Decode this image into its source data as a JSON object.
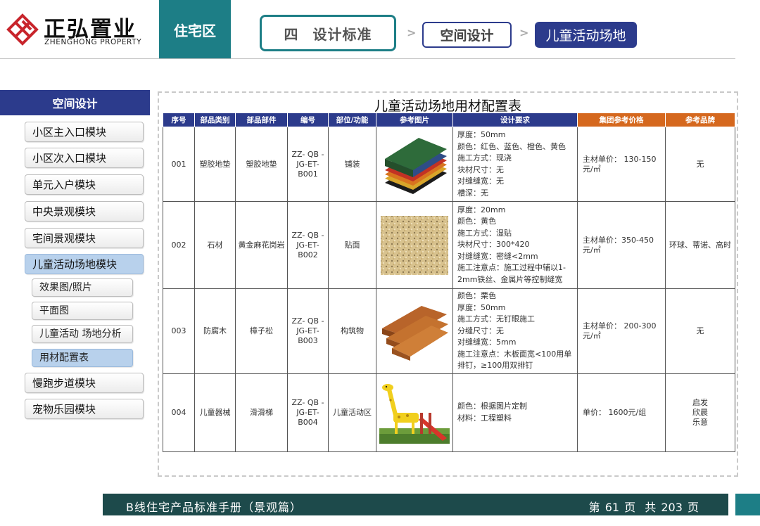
{
  "header": {
    "logo_cn": "正弘置业",
    "logo_en": "ZHENGHONG PROPERTY",
    "zone": "住宅区",
    "crumb_num": "四",
    "crumb_section": "设计标准",
    "crumb_sub": "空间设计",
    "crumb_current": "儿童活动场地"
  },
  "sidebar": {
    "title": "空间设计",
    "items": [
      {
        "label": "小区主入口模块"
      },
      {
        "label": "小区次入口模块"
      },
      {
        "label": "单元入户模块"
      },
      {
        "label": "中央景观模块"
      },
      {
        "label": "宅间景观模块"
      },
      {
        "label": "儿童活动场地模块"
      }
    ],
    "subitems": [
      {
        "label": "效果图/照片"
      },
      {
        "label": "平面图"
      },
      {
        "label": "儿童活动 场地分析"
      },
      {
        "label": "用材配置表"
      }
    ],
    "items_after": [
      {
        "label": "慢跑步道模块"
      },
      {
        "label": "宠物乐园模块"
      }
    ]
  },
  "table": {
    "title": "儿童活动场地用材配置表",
    "headers": [
      "序号",
      "部品类别",
      "部品部件",
      "编号",
      "部位/功能",
      "参考图片",
      "设计要求",
      "集团参考价格",
      "参考品牌"
    ],
    "rows": [
      {
        "no": "001",
        "category": "塑胶地垫",
        "part": "塑胶地垫",
        "code": "ZZ- QB -\nJG-ET-\nB001",
        "function": "铺装",
        "image_icon": "rubber-mat-image",
        "requirement": "厚度：50mm\n颜色：红色、蓝色、橙色、黄色\n施工方式：现浇\n块材尺寸：无\n对缝缝宽：无\n槽深：无",
        "price": "主材单价：  130-150元/㎡",
        "brand": "无"
      },
      {
        "no": "002",
        "category": "石材",
        "part": "黄金麻花岗岩",
        "code": "ZZ- QB -\nJG-ET-\nB002",
        "function": "贴面",
        "image_icon": "granite-image",
        "requirement": "厚度：20mm\n颜色：黄色\n施工方式：湿贴\n块材尺寸：300*420\n对缝缝宽：密缝<2mm\n施工注意点：施工过程中辅以1-2mm铁丝、金属片等控制缝宽",
        "price": "主材单价：350-450元/㎡",
        "brand": "环球、蒂诺、高时"
      },
      {
        "no": "003",
        "category": "防腐木",
        "part": "樟子松",
        "code": "ZZ- QB -\nJG-ET-\nB003",
        "function": "构筑物",
        "image_icon": "timber-planks-image",
        "requirement": "颜色：栗色\n厚度：50mm\n施工方式：无钉眼施工\n分缝尺寸：无\n对缝缝宽：5mm\n施工注意点：木板面宽<100用单排钉，≥100用双排钉",
        "price": "主材单价：  200-300元/㎡",
        "brand": "无"
      },
      {
        "no": "004",
        "category": "儿童器械",
        "part": "滑滑梯",
        "code": "ZZ- QB -\nJG-ET-\nB004",
        "function": "儿童活动区",
        "image_icon": "giraffe-slide-image",
        "requirement": "颜色：根据图片定制\n材料：工程塑料",
        "price": "单价：  1600元/组",
        "brand": "启发\n欣晨\n乐意"
      }
    ]
  },
  "footer": {
    "manual": "B线住宅产品标准手册（景观篇）",
    "page": "第 61 页",
    "total": "共 203 页"
  },
  "colors": {
    "teal": "#1d7e86",
    "navy": "#2c3b8c",
    "orange": "#d5681e",
    "footer": "#1d4a4b",
    "logo_red": "#c8252c",
    "active_item": "#b8d1ec"
  }
}
